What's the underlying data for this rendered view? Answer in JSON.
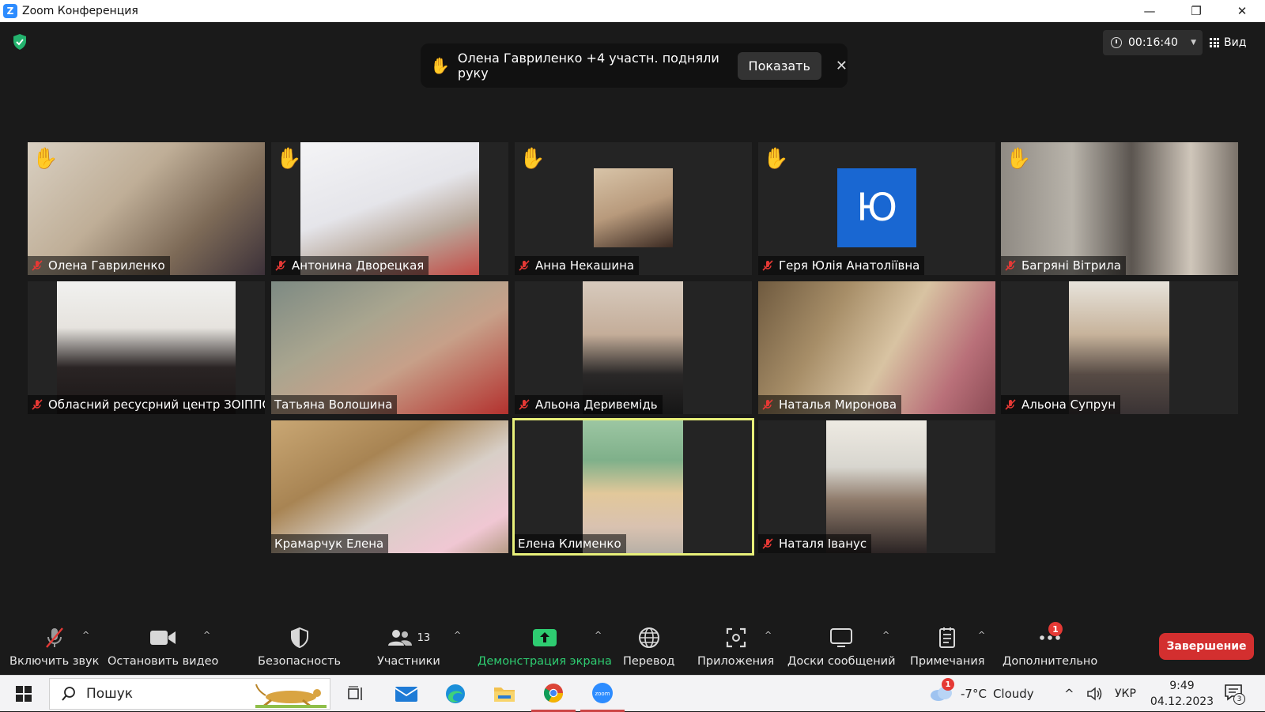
{
  "window": {
    "title": "Zoom Конференция"
  },
  "meeting": {
    "timer": "00:16:40",
    "view_label": "Вид",
    "notification": {
      "text": "Олена Гавриленко +4 участн. подняли руку",
      "show_label": "Показать"
    },
    "participants": [
      {
        "name": "Олена Гавриленко",
        "hand": true,
        "muted": true
      },
      {
        "name": "Антонина Дворецкая",
        "hand": true,
        "muted": true
      },
      {
        "name": "Анна Некашина",
        "hand": true,
        "muted": true
      },
      {
        "name": "Геря Юлія Анатоліївна",
        "hand": true,
        "muted": true,
        "avatar_letter": "Ю"
      },
      {
        "name": "Багряні Вітрила",
        "hand": true,
        "muted": true
      },
      {
        "name": "Обласний ресусрний центр ЗОІППО",
        "hand": false,
        "muted": true
      },
      {
        "name": "Татьяна Волошина",
        "hand": false,
        "muted": false
      },
      {
        "name": "Альона Деривемідь",
        "hand": false,
        "muted": true
      },
      {
        "name": "Наталья Миронова",
        "hand": false,
        "muted": true
      },
      {
        "name": "Альона Супрун",
        "hand": false,
        "muted": true
      },
      {
        "name": "Крамарчук Елена",
        "hand": false,
        "muted": false
      },
      {
        "name": "Елена Клименко",
        "hand": false,
        "muted": false,
        "active_speaker": true
      },
      {
        "name": "Наталя Іванус",
        "hand": false,
        "muted": true
      }
    ]
  },
  "toolbar": {
    "audio": "Включить звук",
    "video": "Остановить видео",
    "security": "Безопасность",
    "participants": "Участники",
    "participants_count": "13",
    "share": "Демонстрация экрана",
    "translate": "Перевод",
    "apps": "Приложения",
    "whiteboards": "Доски сообщений",
    "notes": "Примечания",
    "more": "Дополнительно",
    "more_badge": "1",
    "end": "Завершение"
  },
  "taskbar": {
    "search_placeholder": "Пошук",
    "weather_temp": "-7°C",
    "weather_text": "Cloudy",
    "weather_badge": "1",
    "language": "УКР",
    "time": "9:49",
    "date": "04.12.2023",
    "notifications_count": "3"
  },
  "colors": {
    "accent_green": "#2ecc71",
    "end_red": "#d32f2f",
    "active_outline": "#e8f07a",
    "avatar_blue": "#1967d2"
  }
}
